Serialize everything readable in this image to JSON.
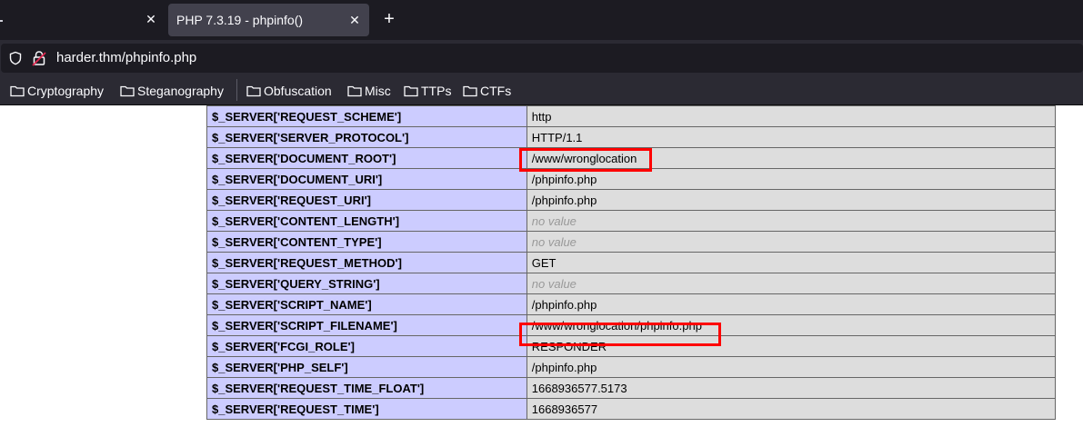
{
  "browser": {
    "tabs": [
      {
        "title": "",
        "active": false
      },
      {
        "title": "PHP 7.3.19 - phpinfo()",
        "active": true
      }
    ],
    "close_glyph": "✕",
    "new_tab_glyph": "+",
    "url": "harder.thm/phpinfo.php",
    "bookmarks": [
      "Cryptography",
      "Steganography",
      "Obfuscation",
      "Misc",
      "TTPs",
      "CTFs"
    ]
  },
  "server_vars": [
    {
      "name": "$_SERVER['REQUEST_SCHEME']",
      "value": "http"
    },
    {
      "name": "$_SERVER['SERVER_PROTOCOL']",
      "value": "HTTP/1.1"
    },
    {
      "name": "$_SERVER['DOCUMENT_ROOT']",
      "value": "/www/wronglocation",
      "highlighted": true
    },
    {
      "name": "$_SERVER['DOCUMENT_URI']",
      "value": "/phpinfo.php"
    },
    {
      "name": "$_SERVER['REQUEST_URI']",
      "value": "/phpinfo.php"
    },
    {
      "name": "$_SERVER['CONTENT_LENGTH']",
      "value": "no value",
      "empty": true
    },
    {
      "name": "$_SERVER['CONTENT_TYPE']",
      "value": "no value",
      "empty": true
    },
    {
      "name": "$_SERVER['REQUEST_METHOD']",
      "value": "GET"
    },
    {
      "name": "$_SERVER['QUERY_STRING']",
      "value": "no value",
      "empty": true
    },
    {
      "name": "$_SERVER['SCRIPT_NAME']",
      "value": "/phpinfo.php"
    },
    {
      "name": "$_SERVER['SCRIPT_FILENAME']",
      "value": "/www/wronglocation/phpinfo.php",
      "highlighted": true
    },
    {
      "name": "$_SERVER['FCGI_ROLE']",
      "value": "RESPONDER"
    },
    {
      "name": "$_SERVER['PHP_SELF']",
      "value": "/phpinfo.php"
    },
    {
      "name": "$_SERVER['REQUEST_TIME_FLOAT']",
      "value": "1668936577.5173"
    },
    {
      "name": "$_SERVER['REQUEST_TIME']",
      "value": "1668936577"
    }
  ],
  "colors": {
    "key_cell": "#ccccff",
    "value_cell": "#dddddd",
    "highlight": "#ff0000",
    "toolbar": "#2b2a33",
    "tab_strip": "#1c1b22"
  }
}
